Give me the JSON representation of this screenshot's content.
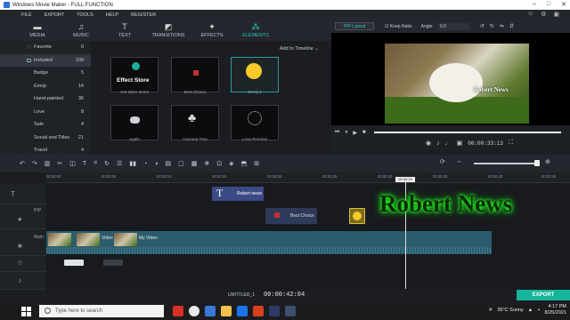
{
  "window": {
    "title": "Windows Movie Maker - FULL FUNCTION"
  },
  "menu": [
    "FILE",
    "EXPORT",
    "TOOLS",
    "HELP",
    "REGISTER"
  ],
  "tabs": [
    {
      "label": "MEDIA",
      "icon": "folder-icon",
      "glyph": "▬"
    },
    {
      "label": "MUSIC",
      "icon": "music-note-icon",
      "glyph": "♫"
    },
    {
      "label": "TEXT",
      "icon": "text-icon",
      "glyph": "T"
    },
    {
      "label": "TRANSITIONS",
      "icon": "transitions-icon",
      "glyph": "◩"
    },
    {
      "label": "EFFECTS",
      "icon": "effects-icon",
      "glyph": "✦"
    },
    {
      "label": "ELEMENTS",
      "icon": "elements-icon",
      "glyph": "⁂"
    }
  ],
  "sidebar": {
    "items": [
      {
        "label": "Favorite",
        "count": "0"
      },
      {
        "label": "Included",
        "count": "109"
      },
      {
        "label": "Badge",
        "count": "5"
      },
      {
        "label": "Emoji",
        "count": "14"
      },
      {
        "label": "Hand-painted",
        "count": "36"
      },
      {
        "label": "Love",
        "count": "8"
      },
      {
        "label": "Sale",
        "count": "4"
      },
      {
        "label": "Social and Titles",
        "count": "21"
      },
      {
        "label": "Travel",
        "count": "4"
      }
    ]
  },
  "content": {
    "add_to_timeline": "Add to Timeline",
    "thumbs": [
      {
        "label": "Get More Items",
        "inner": "Effect Store"
      },
      {
        "label": "Best Choice"
      },
      {
        "label": "Emoji 1"
      },
      {
        "label": "Apple"
      },
      {
        "label": "Coconut Tree"
      },
      {
        "label": "Love Promise"
      }
    ]
  },
  "preview": {
    "pip_layout": "PIP Layout",
    "keep_ratio": "Keep Ratio",
    "angle_label": "Angle:",
    "angle_value": "0.0",
    "watermark": "Robert News",
    "timecode": "00:00:33:13"
  },
  "timeline": {
    "ticks": [
      "00:00:00",
      "00:00:05",
      "00:00:10",
      "00:00:15",
      "00:00:20",
      "00:00:25",
      "00:00:30",
      "00:00:35",
      "00:00:40",
      "00:00:45"
    ],
    "playhead_time": "00:00:33",
    "track_labels": {
      "pip": "PIP",
      "main": "Main"
    },
    "title_clip": "Robert news",
    "pip_clip": "Best Choice",
    "video_label": "Video",
    "main_clip": "My Video",
    "overlay_text": "Robert News"
  },
  "footer": {
    "project": "UNTITLED_1",
    "timecode": "00:00:42:04",
    "export": "EXPORT"
  },
  "taskbar": {
    "search_placeholder": "Type here to search",
    "weather": "35°C Sunny",
    "time": "4:17 PM",
    "date": "8/25/2021"
  },
  "colors": {
    "accent": "#28c9b8",
    "export": "#14b59a",
    "main_clip": "#2b5c6b",
    "title_clip": "#3b4a84",
    "glow": "#22ff22"
  }
}
